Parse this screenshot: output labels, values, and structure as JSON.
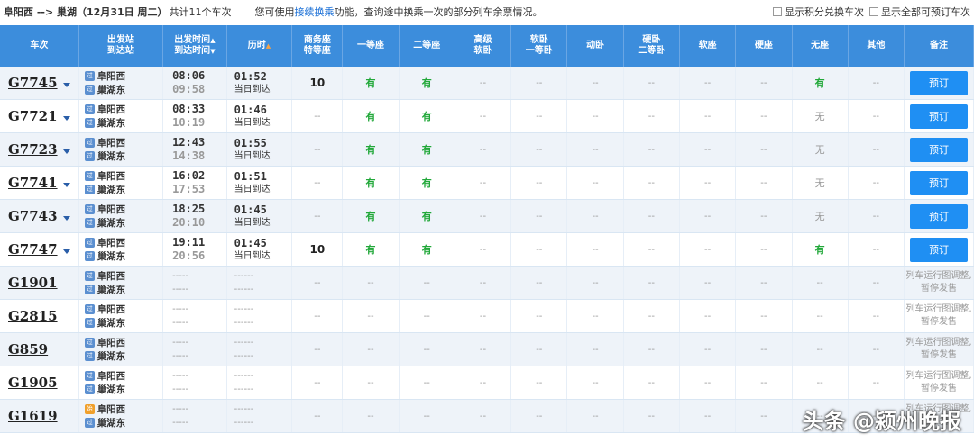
{
  "top": {
    "route": "阜阳西 --> 巢湖",
    "date": "（12月31日 周二）",
    "count": "共计11个车次",
    "hint_pre": "您可使用",
    "hint_link": "接续换乘",
    "hint_post": "功能，查询途中换乘一次的部分列车余票情况。",
    "opt1": "显示积分兑换车次",
    "opt2": "显示全部可预订车次"
  },
  "headers": {
    "train": "车次",
    "station_1": "出发站",
    "station_2": "到达站",
    "time_1": "出发时间",
    "time_2": "到达时间",
    "duration": "历时",
    "seats": [
      [
        "商务座",
        "特等座"
      ],
      [
        "一等座"
      ],
      [
        "二等座"
      ],
      [
        "高级",
        "软卧"
      ],
      [
        "软卧",
        "一等卧"
      ],
      [
        "动卧"
      ],
      [
        "硬卧",
        "二等卧"
      ],
      [
        "软座"
      ],
      [
        "硬座"
      ],
      [
        "无座"
      ],
      [
        "其他"
      ]
    ],
    "note": "备注"
  },
  "book_label": "预订",
  "dep_icon": "始",
  "pass_icon": "过",
  "rows": [
    {
      "train": "G7745",
      "from": "阜阳西",
      "to": "巢湖东",
      "from_icon": "过",
      "to_icon": "过",
      "dep": "08:06",
      "arr": "09:58",
      "dur": "01:52",
      "arrive": "当日到达",
      "seats": [
        "10",
        "有",
        "有",
        "--",
        "--",
        "--",
        "--",
        "--",
        "--",
        "有",
        "--"
      ],
      "bookable": true,
      "note": ""
    },
    {
      "train": "G7721",
      "from": "阜阳西",
      "to": "巢湖东",
      "from_icon": "过",
      "to_icon": "过",
      "dep": "08:33",
      "arr": "10:19",
      "dur": "01:46",
      "arrive": "当日到达",
      "seats": [
        "--",
        "有",
        "有",
        "--",
        "--",
        "--",
        "--",
        "--",
        "--",
        "无",
        "--"
      ],
      "bookable": true,
      "note": ""
    },
    {
      "train": "G7723",
      "from": "阜阳西",
      "to": "巢湖东",
      "from_icon": "过",
      "to_icon": "过",
      "dep": "12:43",
      "arr": "14:38",
      "dur": "01:55",
      "arrive": "当日到达",
      "seats": [
        "--",
        "有",
        "有",
        "--",
        "--",
        "--",
        "--",
        "--",
        "--",
        "无",
        "--"
      ],
      "bookable": true,
      "note": ""
    },
    {
      "train": "G7741",
      "from": "阜阳西",
      "to": "巢湖东",
      "from_icon": "过",
      "to_icon": "过",
      "dep": "16:02",
      "arr": "17:53",
      "dur": "01:51",
      "arrive": "当日到达",
      "seats": [
        "--",
        "有",
        "有",
        "--",
        "--",
        "--",
        "--",
        "--",
        "--",
        "无",
        "--"
      ],
      "bookable": true,
      "note": ""
    },
    {
      "train": "G7743",
      "from": "阜阳西",
      "to": "巢湖东",
      "from_icon": "过",
      "to_icon": "过",
      "dep": "18:25",
      "arr": "20:10",
      "dur": "01:45",
      "arrive": "当日到达",
      "seats": [
        "--",
        "有",
        "有",
        "--",
        "--",
        "--",
        "--",
        "--",
        "--",
        "无",
        "--"
      ],
      "bookable": true,
      "note": ""
    },
    {
      "train": "G7747",
      "from": "阜阳西",
      "to": "巢湖东",
      "from_icon": "过",
      "to_icon": "过",
      "dep": "19:11",
      "arr": "20:56",
      "dur": "01:45",
      "arrive": "当日到达",
      "seats": [
        "10",
        "有",
        "有",
        "--",
        "--",
        "--",
        "--",
        "--",
        "--",
        "有",
        "--"
      ],
      "bookable": true,
      "note": ""
    },
    {
      "train": "G1901",
      "from": "阜阳西",
      "to": "巢湖东",
      "from_icon": "过",
      "to_icon": "过",
      "dep": "-----",
      "arr": "-----",
      "dur": "------",
      "arrive": "------",
      "seats": [
        "--",
        "--",
        "--",
        "--",
        "--",
        "--",
        "--",
        "--",
        "--",
        "--",
        "--"
      ],
      "bookable": false,
      "note": "列车运行图调整,暂停发售"
    },
    {
      "train": "G2815",
      "from": "阜阳西",
      "to": "巢湖东",
      "from_icon": "过",
      "to_icon": "过",
      "dep": "-----",
      "arr": "-----",
      "dur": "------",
      "arrive": "------",
      "seats": [
        "--",
        "--",
        "--",
        "--",
        "--",
        "--",
        "--",
        "--",
        "--",
        "--",
        "--"
      ],
      "bookable": false,
      "note": "列车运行图调整,暂停发售"
    },
    {
      "train": "G859",
      "from": "阜阳西",
      "to": "巢湖东",
      "from_icon": "过",
      "to_icon": "过",
      "dep": "-----",
      "arr": "-----",
      "dur": "------",
      "arrive": "------",
      "seats": [
        "--",
        "--",
        "--",
        "--",
        "--",
        "--",
        "--",
        "--",
        "--",
        "--",
        "--"
      ],
      "bookable": false,
      "note": "列车运行图调整,暂停发售"
    },
    {
      "train": "G1905",
      "from": "阜阳西",
      "to": "巢湖东",
      "from_icon": "过",
      "to_icon": "过",
      "dep": "-----",
      "arr": "-----",
      "dur": "------",
      "arrive": "------",
      "seats": [
        "--",
        "--",
        "--",
        "--",
        "--",
        "--",
        "--",
        "--",
        "--",
        "--",
        "--"
      ],
      "bookable": false,
      "note": "列车运行图调整,暂停发售"
    },
    {
      "train": "G1619",
      "from": "阜阳西",
      "to": "巢湖东",
      "from_icon": "始",
      "to_icon": "过",
      "dep": "-----",
      "arr": "-----",
      "dur": "------",
      "arrive": "------",
      "seats": [
        "--",
        "--",
        "--",
        "--",
        "--",
        "--",
        "--",
        "--",
        "--",
        "--",
        "--"
      ],
      "bookable": false,
      "note": "列车运行图调整,暂停发售"
    }
  ],
  "watermark": "头条 @颍州晚报"
}
